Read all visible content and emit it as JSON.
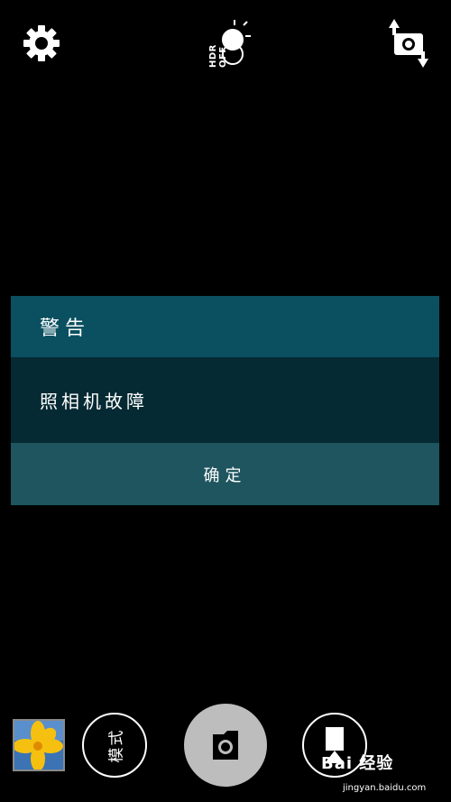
{
  "top_bar": {
    "settings_icon": "gear-icon",
    "hdr_label": "HDR OFF",
    "switch_camera_icon": "switch-camera-icon"
  },
  "dialog": {
    "title": "警告",
    "message": "照相机故障",
    "ok_button": "确定",
    "colors": {
      "title_bg": "#0a5060",
      "message_bg": "#052a33",
      "button_bg": "#1e555f"
    }
  },
  "bottom_bar": {
    "gallery_icon": "gallery-thumbnail",
    "mode_label": "模式",
    "shutter_icon": "camera-shutter-icon",
    "video_icon": "video-record-icon"
  },
  "watermark": {
    "brand": "Bai 经验",
    "url": "jingyan.baidu.com"
  }
}
